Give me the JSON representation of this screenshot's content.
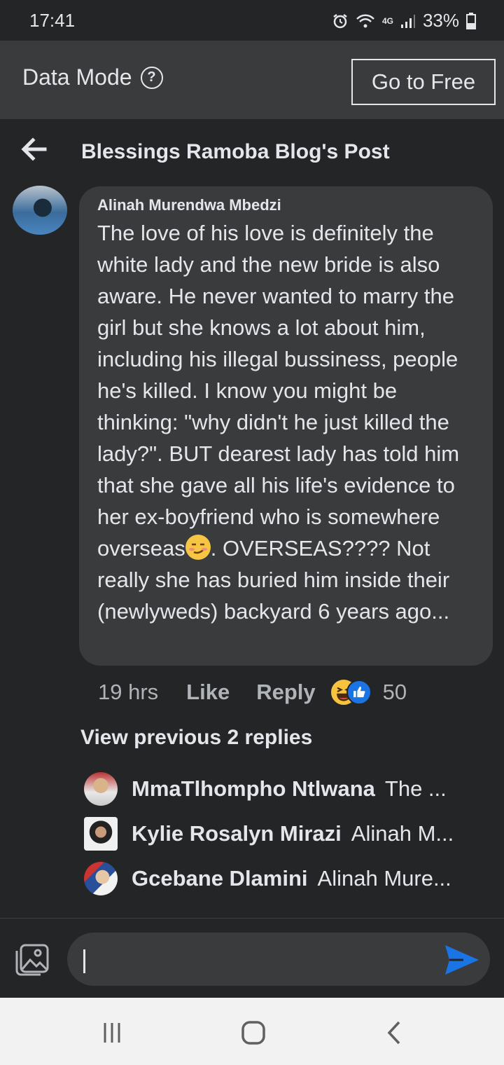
{
  "status_bar": {
    "time": "17:41",
    "network": "4G",
    "battery": "33%",
    "icons": [
      "alarm-icon",
      "wifi-icon",
      "signal-icon",
      "battery-icon"
    ]
  },
  "data_mode": {
    "title": "Data Mode",
    "help_icon": "?",
    "go_free_label": "Go to Free"
  },
  "header": {
    "title": "Blessings Ramoba Blog's Post"
  },
  "comment": {
    "author": "Alinah Murendwa Mbedzi",
    "text_part1": "The love of his love is definitely the white lady and the new bride is also aware. He never wanted to marry the girl but she knows a lot about him, including his illegal bussiness, people he's killed. I know you might be thinking: \"why didn't he just killed the lady?\". BUT dearest lady has told him that she gave all his life's evidence to her ex-boyfriend who is somewhere overseas",
    "text_part2": ". OVERSEAS???? Not really she has buried him inside their (newlyweds) backyard 6 years ago...",
    "time": "19 hrs",
    "like_label": "Like",
    "reply_label": "Reply",
    "reaction_count": "50"
  },
  "replies": {
    "view_previous": "View previous 2 replies",
    "items": [
      {
        "name": "MmaTlhompho Ntlwana",
        "snippet": "The ..."
      },
      {
        "name": "Kylie Rosalyn Mirazi",
        "snippet": "Alinah M..."
      },
      {
        "name": "Gcebane Dlamini",
        "snippet": "Alinah Mure..."
      }
    ]
  },
  "composer": {
    "input_value": "",
    "placeholder": ""
  },
  "colors": {
    "background": "#242526",
    "bubble": "#3a3b3c",
    "accent": "#1b74e4",
    "text": "#e4e6eb",
    "muted": "#b0b3b8"
  }
}
